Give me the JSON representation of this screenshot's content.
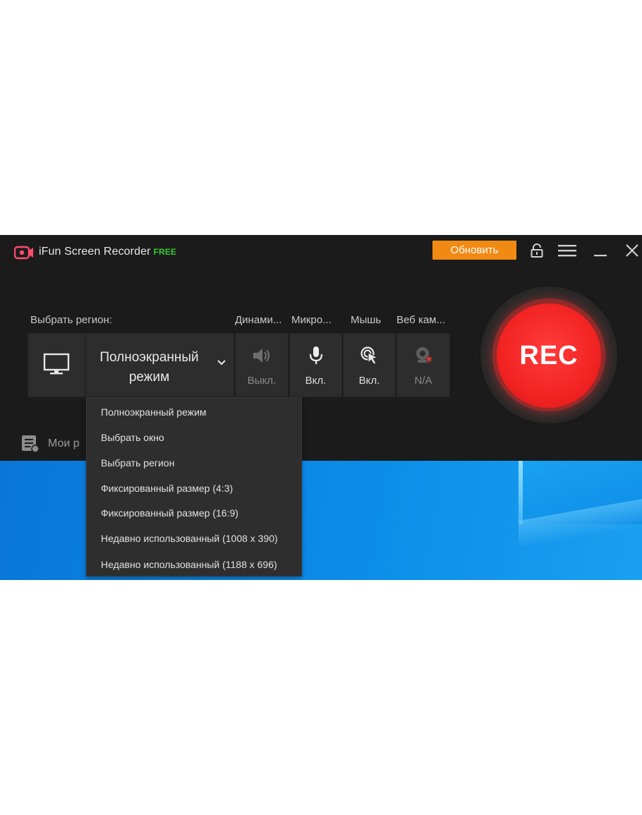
{
  "app": {
    "title": "iFun Screen Recorder",
    "badge": "FREE",
    "upgrade_label": "Обновить"
  },
  "labels": {
    "region": "Выбрать регион:",
    "speaker": "Динами...",
    "microphone": "Микро...",
    "mouse": "Мышь",
    "webcam": "Веб кам..."
  },
  "tiles": {
    "mode_line1": "Полноэкранный",
    "mode_line2": "режим",
    "speaker_state": "Выкл.",
    "mic_state": "Вкл.",
    "mouse_state": "Вкл.",
    "webcam_state": "N/A"
  },
  "rec_label": "REC",
  "my_recordings": "Мои р",
  "dropdown": [
    "Полноэкранный режим",
    "Выбрать окно",
    "Выбрать регион",
    "Фиксированный размер (4:3)",
    "Фиксированный размер (16:9)",
    "Недавно использованный (1008 x 390)",
    "Недавно использованный (1188 x 696)"
  ],
  "colors": {
    "app_bg": "#1b1b1b",
    "tile_bg": "#2d2d2d",
    "accent_orange": "#f18a13",
    "rec_red": "#f22323",
    "free_green": "#33cc33",
    "desktop_blue": "#0b86e6"
  },
  "icons": [
    "app-logo-icon",
    "lock-icon",
    "menu-icon",
    "minimize-icon",
    "close-icon",
    "monitor-icon",
    "chevron-down-icon",
    "speaker-icon",
    "microphone-icon",
    "mouse-cursor-icon",
    "webcam-icon",
    "recordings-list-icon"
  ]
}
